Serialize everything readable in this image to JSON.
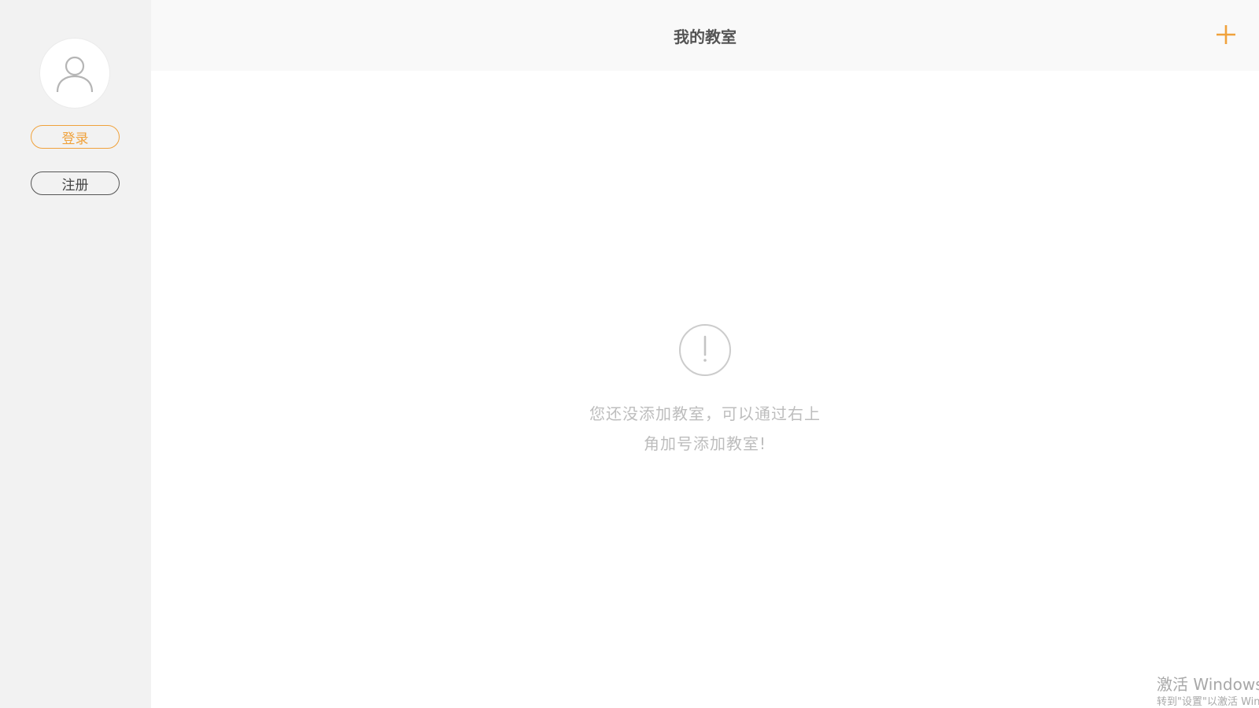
{
  "header": {
    "title": "我的教室",
    "add_icon": "plus-icon",
    "accent_color": "#f0a23c"
  },
  "sidebar": {
    "avatar_icon": "user-icon",
    "login_label": "登录",
    "register_label": "注册"
  },
  "empty_state": {
    "icon": "exclamation-circle-icon",
    "message": "您还没添加教室，可以通过右上角加号添加教室!"
  },
  "watermark": {
    "line1": "激活 Windows",
    "line2": "转到\"设置\"以激活 Windows。"
  }
}
